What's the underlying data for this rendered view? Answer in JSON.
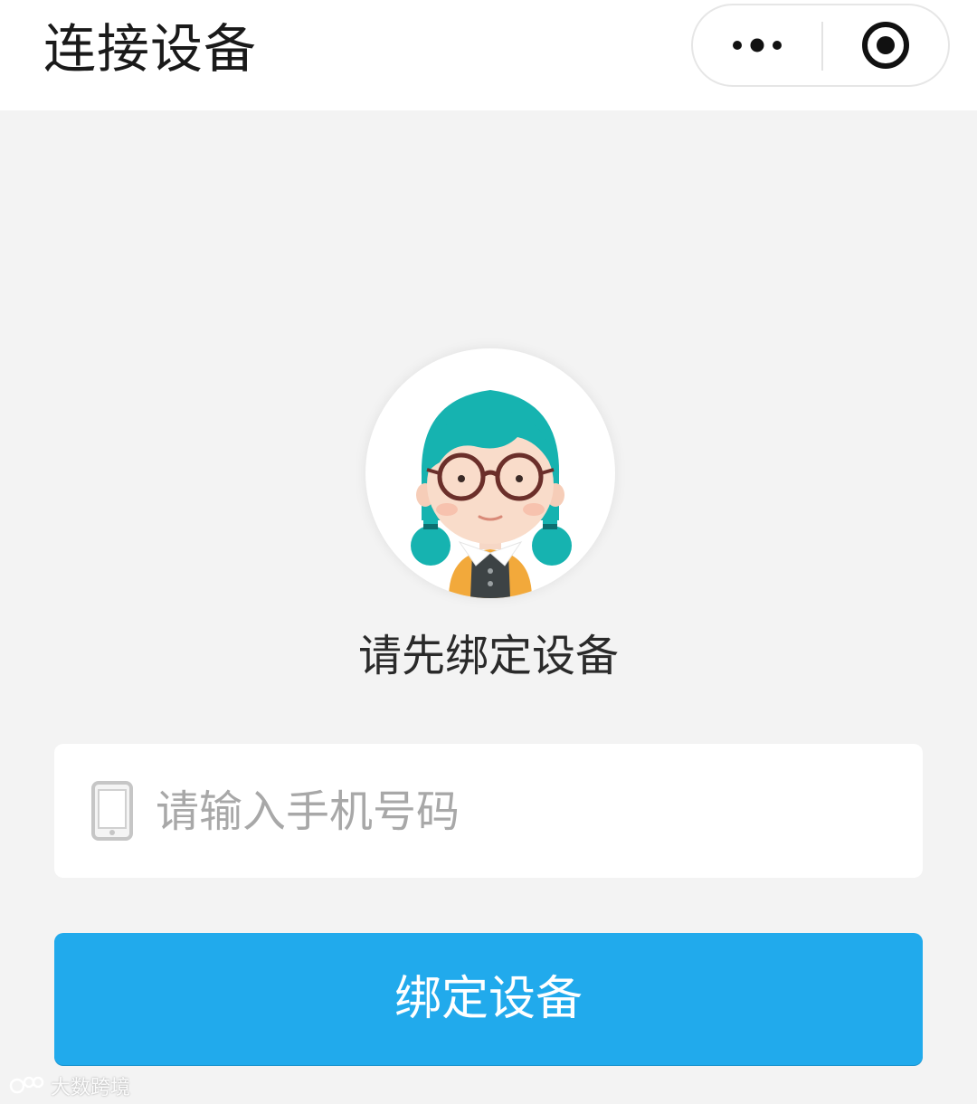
{
  "nav": {
    "title": "连接设备",
    "more_icon": "more-dots-icon",
    "close_icon": "target-close-icon"
  },
  "main": {
    "avatar_icon": "girl-avatar-illustration",
    "prompt": "请先绑定设备",
    "phone_field": {
      "icon": "mobile-phone-icon",
      "placeholder": "请输入手机号码",
      "value": ""
    },
    "bind_button": "绑定设备"
  },
  "watermark": {
    "text": "大数跨境"
  },
  "colors": {
    "accent": "#21aaec",
    "background": "#f3f3f3",
    "hair": "#16b3b0"
  }
}
